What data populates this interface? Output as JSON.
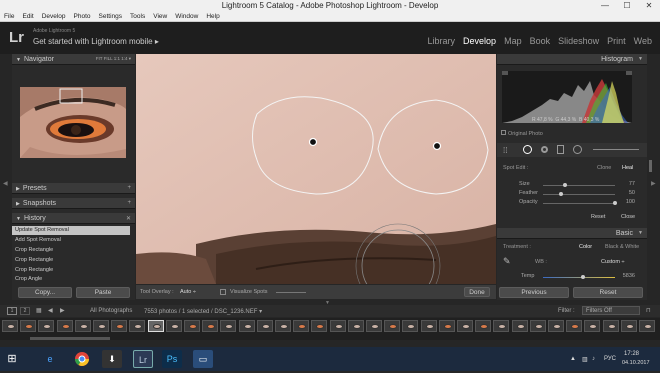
{
  "window": {
    "title": "Lightroom 5 Catalog - Adobe Photoshop Lightroom - Develop",
    "minimize": "—",
    "maximize": "☐",
    "close": "✕"
  },
  "menu": [
    "File",
    "Edit",
    "Develop",
    "Photo",
    "Settings",
    "Tools",
    "View",
    "Window",
    "Help"
  ],
  "identity": {
    "logo": "Lr",
    "line1": "Adobe Lightroom 5",
    "line2": "Get started with Lightroom mobile ▸"
  },
  "modules": [
    "Library",
    "Develop",
    "Map",
    "Book",
    "Slideshow",
    "Print",
    "Web"
  ],
  "left": {
    "navigator": {
      "title": "Navigator",
      "zoom": "FIT   FILL   1:1   1:4 ▾"
    },
    "presets": "Presets",
    "snapshots": "Snapshots",
    "history": {
      "title": "History",
      "items": [
        "Update Spot Removal",
        "Add Spot Removal",
        "Crop Rectangle",
        "Crop Rectangle",
        "Crop Rectangle",
        "Crop Angle"
      ]
    },
    "copy": "Copy...",
    "paste": "Paste"
  },
  "toolbar": {
    "overlay_label": "Tool Overlay :",
    "overlay_value": "Auto ÷",
    "visualize": "Visualize Spots",
    "done": "Done"
  },
  "right": {
    "histogram": "Histogram",
    "readout": {
      "r_label": "R",
      "r": "47,8",
      "g_label": "G",
      "g": "44,3",
      "b_label": "B",
      "b": "40,3",
      "pct": "%"
    },
    "original": "Original Photo",
    "spot": {
      "label": "Spot Edit :",
      "clone": "Clone",
      "heal": "Heal",
      "sliders": [
        {
          "name": "Size",
          "value": "77",
          "pos": 0.3
        },
        {
          "name": "Feather",
          "value": "50",
          "pos": 0.25
        },
        {
          "name": "Opacity",
          "value": "100",
          "pos": 1.0
        }
      ],
      "reset": "Reset",
      "close": "Close"
    },
    "basic": {
      "title": "Basic",
      "treatment": "Treatment :",
      "color": "Color",
      "bw": "Black & White",
      "wb": "WB :",
      "wb_value": "Custom ÷",
      "temp": "Temp",
      "temp_value": "5836"
    },
    "previous": "Previous",
    "reset": "Reset"
  },
  "filmbar": {
    "page1": "1",
    "page2": "2",
    "source": "All Photographs",
    "count": "7553 photos / 1 selected / DSC_1236.NEF ▾",
    "filter": "Filter :",
    "filter_value": "Filters Off"
  },
  "taskbar": {
    "lang": "РУС",
    "time": "17:28",
    "date": "04.10.2017"
  }
}
